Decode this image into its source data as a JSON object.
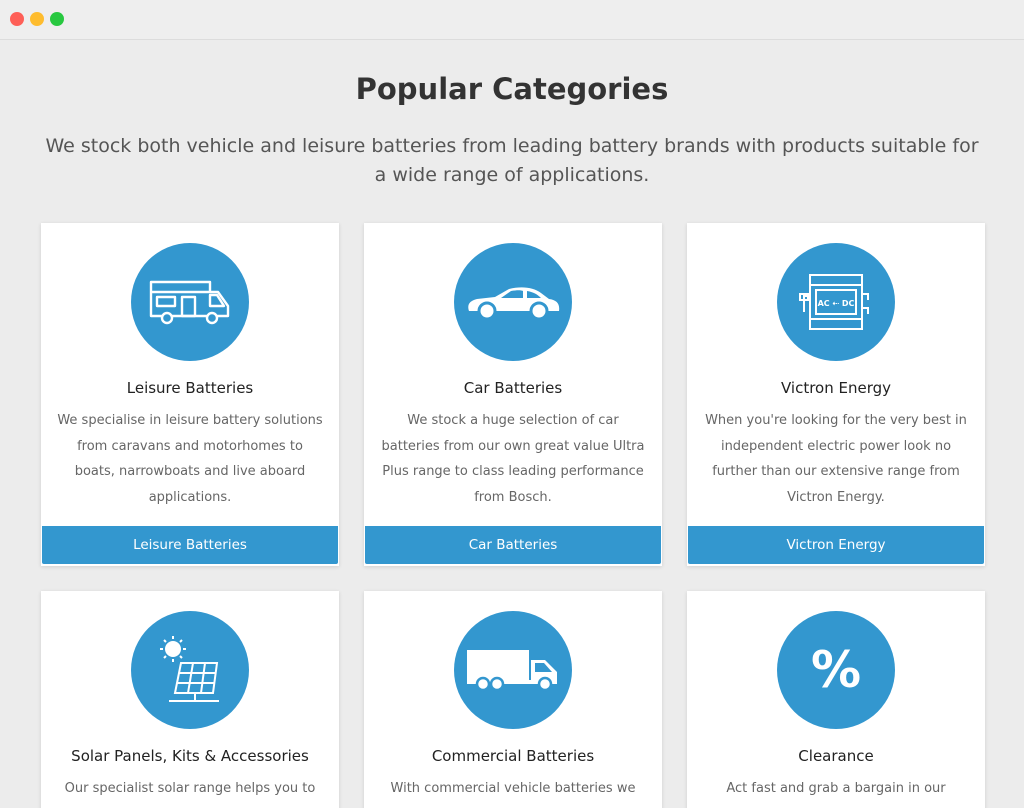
{
  "window": {
    "controls": [
      "close",
      "minimize",
      "maximize"
    ]
  },
  "section": {
    "title": "Popular Categories",
    "intro": "We stock both vehicle and leisure batteries from leading battery brands with products suitable for a wide range of applications."
  },
  "colors": {
    "accent": "#3397cf",
    "background": "#ececec"
  },
  "cards": [
    {
      "icon": "motorhome-icon",
      "title": "Leisure Batteries",
      "text": "We specialise in leisure battery solutions from caravans and motorhomes to boats, narrowboats and live aboard applications.",
      "button": "Leisure Batteries"
    },
    {
      "icon": "car-icon",
      "title": "Car Batteries",
      "text": "We stock a huge selection of car batteries from our own great value Ultra Plus range to class leading performance from Bosch.",
      "button": "Car Batteries"
    },
    {
      "icon": "inverter-icon",
      "icon_label": "AC ⇠ DC",
      "title": "Victron Energy",
      "text": "When you're looking for the very best in independent electric power look no further than our extensive range from Victron Energy.",
      "button": "Victron Energy"
    },
    {
      "icon": "solar-panel-icon",
      "title": "Solar Panels, Kits & Accessories",
      "text": "Our specialist solar range helps you to"
    },
    {
      "icon": "truck-icon",
      "title": "Commercial Batteries",
      "text": "With commercial vehicle batteries we"
    },
    {
      "icon": "percent-icon",
      "icon_label": "%",
      "title": "Clearance",
      "text": "Act fast and grab a bargain in our"
    }
  ]
}
